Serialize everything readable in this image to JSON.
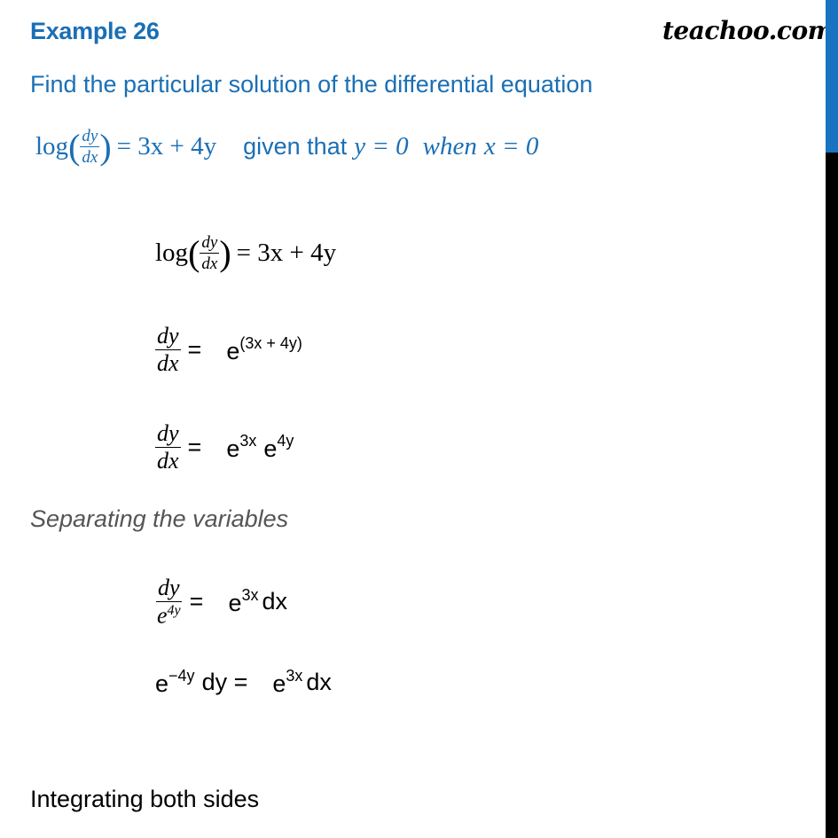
{
  "header": {
    "title": "Example 26",
    "brand": "teachoo.com"
  },
  "question": {
    "text": "Find the particular solution of the differential equation",
    "equation": {
      "log": "log",
      "num": "dy",
      "den": "dx",
      "rhs": "= 3x + 4y",
      "given": "given that",
      "condition_y": "y = 0",
      "when": "when",
      "condition_x": "x = 0"
    }
  },
  "steps": [
    {
      "log": "log",
      "num": "dy",
      "den": "dx",
      "rhs": "= 3x + 4y"
    },
    {
      "num": "dy",
      "den": "dx",
      "eq": "=",
      "base": "e",
      "exp": "(3x + 4y)"
    },
    {
      "num": "dy",
      "den": "dx",
      "eq": "=",
      "base1": "e",
      "exp1": "3x",
      "base2": "e",
      "exp2": "4y"
    }
  ],
  "separating": {
    "label": "Separating the variables",
    "steps": [
      {
        "num": "dy",
        "den_base": "e",
        "den_exp": "4y",
        "eq": "=",
        "base": "e",
        "exp": "3x",
        "tail": "dx"
      },
      {
        "base1": "e",
        "exp1": "−4y",
        "mid": "dy =",
        "base2": "e",
        "exp2": "3x",
        "tail": "dx"
      }
    ]
  },
  "closing": "Integrating both sides",
  "colors": {
    "accent": "#1a6fb5",
    "sidebar_blue": "#1a73c0",
    "sidebar_black": "#000000",
    "muted": "#555555"
  }
}
